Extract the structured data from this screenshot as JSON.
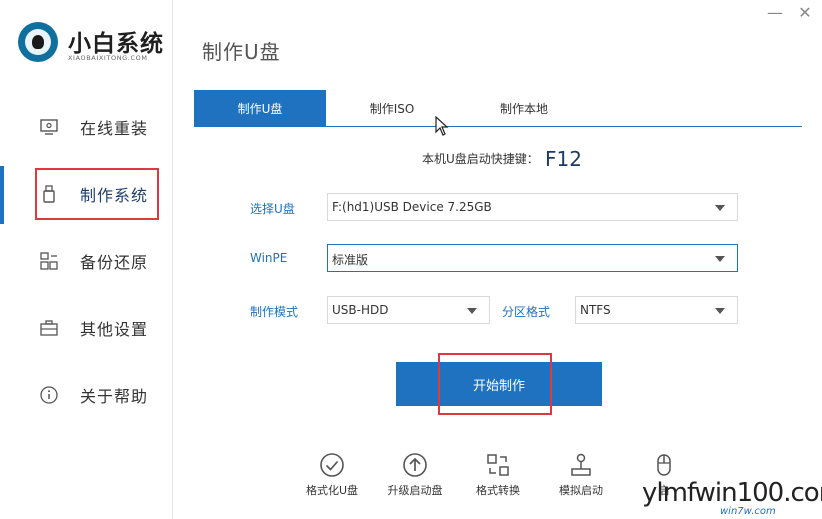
{
  "app": {
    "logo_title": "小白系统",
    "logo_sub": "XIAOBAIXITONG.COM",
    "page_title": "制作U盘",
    "minimize_glyph": "—",
    "close_glyph": "✕"
  },
  "sidebar": {
    "items": [
      {
        "label": "在线重装",
        "icon": "monitor-icon"
      },
      {
        "label": "制作系统",
        "icon": "usb-drive-icon",
        "active": true
      },
      {
        "label": "备份还原",
        "icon": "backup-grid-icon"
      },
      {
        "label": "其他设置",
        "icon": "briefcase-icon"
      },
      {
        "label": "关于帮助",
        "icon": "info-icon"
      }
    ]
  },
  "tabs": [
    {
      "label": "制作U盘",
      "active": true
    },
    {
      "label": "制作ISO"
    },
    {
      "label": "制作本地"
    }
  ],
  "hotkey": {
    "label": "本机U盘启动快捷键：",
    "key": "F12"
  },
  "form": {
    "usb_label": "选择U盘",
    "usb_value": "F:(hd1)USB Device 7.25GB",
    "winpe_label": "WinPE",
    "winpe_value": "标准版",
    "mode_label": "制作模式",
    "mode_value": "USB-HDD",
    "partition_label": "分区格式",
    "partition_value": "NTFS"
  },
  "start_button": "开始制作",
  "tools": [
    {
      "label": "格式化U盘",
      "icon": "check-circle-icon"
    },
    {
      "label": "升级启动盘",
      "icon": "upgrade-arrow-icon"
    },
    {
      "label": "格式转换",
      "icon": "convert-icon"
    },
    {
      "label": "模拟启动",
      "icon": "joystick-icon"
    },
    {
      "label": "启",
      "icon": "mouse-icon"
    }
  ],
  "watermark": {
    "main": "ylmfwin100.com",
    "sub": "win7w.com"
  },
  "colors": {
    "accent": "#1e72c0",
    "highlight": "#e0383f"
  }
}
